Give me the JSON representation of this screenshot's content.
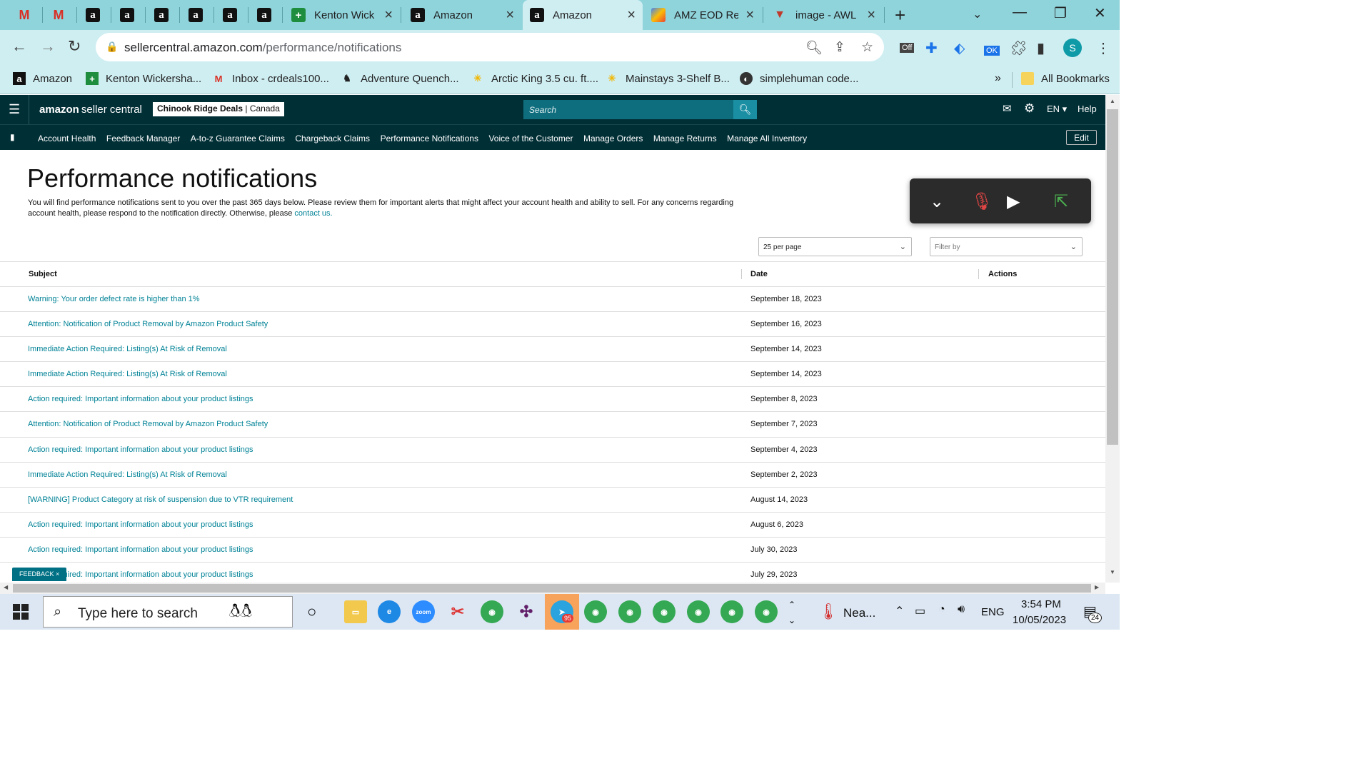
{
  "browser": {
    "tabs": [
      {
        "icon": "gmail-icon",
        "title": ""
      },
      {
        "icon": "gmail-icon",
        "title": ""
      },
      {
        "icon": "amazon-icon",
        "title": ""
      },
      {
        "icon": "amazon-icon",
        "title": ""
      },
      {
        "icon": "amazon-icon",
        "title": ""
      },
      {
        "icon": "amazon-icon",
        "title": ""
      },
      {
        "icon": "amazon-icon",
        "title": ""
      },
      {
        "icon": "amazon-icon",
        "title": ""
      },
      {
        "icon": "sheets-icon",
        "title": "Kenton Wick"
      },
      {
        "icon": "amazon-icon",
        "title": "Amazon"
      },
      {
        "icon": "amazon-icon",
        "title": "Amazon"
      },
      {
        "icon": "colorful-app-icon",
        "title": "AMZ EOD Re"
      },
      {
        "icon": "awl-icon",
        "title": "image - AWL"
      }
    ],
    "url_host": "sellercentral.amazon.com",
    "url_path": "/performance/notifications",
    "bookmarks": [
      {
        "icon": "amazon-icon",
        "label": "Amazon"
      },
      {
        "icon": "plus-icon",
        "label": "Kenton Wickersha..."
      },
      {
        "icon": "gmail-icon",
        "label": "Inbox - crdeals100..."
      },
      {
        "icon": "moose-icon",
        "label": "Adventure Quench..."
      },
      {
        "icon": "walmart-icon",
        "label": "Arctic King 3.5 cu. ft...."
      },
      {
        "icon": "walmart-icon",
        "label": "Mainstays 3-Shelf B..."
      },
      {
        "icon": "globe-icon",
        "label": "simplehuman code..."
      }
    ],
    "bookmarks_overflow": "»",
    "all_bookmarks": "All Bookmarks",
    "profile_initial": "S",
    "ext_off_badge": "Off",
    "ext_ok_badge": "OK"
  },
  "seller_central": {
    "logo_brand": "amazon",
    "logo_product": "seller central",
    "store_name": "Chinook Ridge Deals",
    "store_region": "Canada",
    "search_placeholder": "Search",
    "language": "EN",
    "help": "Help",
    "nav_links": [
      "Account Health",
      "Feedback Manager",
      "A-to-z Guarantee Claims",
      "Chargeback Claims",
      "Performance Notifications",
      "Voice of the Customer",
      "Manage Orders",
      "Manage Returns",
      "Manage All Inventory"
    ],
    "edit_label": "Edit"
  },
  "page": {
    "title": "Performance notifications",
    "intro": "You will find performance notifications sent to you over the past 365 days below. Please review them for important alerts that might affect your account health and ability to sell. For any concerns regarding account health, please respond to the notification directly. Otherwise, please ",
    "contact_link": "contact us.",
    "per_page": "25 per page",
    "filter_placeholder": "Filter by",
    "columns": {
      "subject": "Subject",
      "date": "Date",
      "actions": "Actions"
    },
    "rows": [
      {
        "subject": "Warning: Your order defect rate is higher than 1%",
        "date": "September 18, 2023"
      },
      {
        "subject": "Attention: Notification of Product Removal by Amazon Product Safety",
        "date": "September 16, 2023"
      },
      {
        "subject": "Immediate Action Required: Listing(s) At Risk of Removal",
        "date": "September 14, 2023"
      },
      {
        "subject": "Immediate Action Required: Listing(s) At Risk of Removal",
        "date": "September 14, 2023"
      },
      {
        "subject": "Action required: Important information about your product listings",
        "date": "September 8, 2023"
      },
      {
        "subject": "Attention: Notification of Product Removal by Amazon Product Safety",
        "date": "September 7, 2023"
      },
      {
        "subject": "Action required: Important information about your product listings",
        "date": "September 4, 2023"
      },
      {
        "subject": "Immediate Action Required: Listing(s) At Risk of Removal",
        "date": "September 2, 2023"
      },
      {
        "subject": "[WARNING] Product Category at risk of suspension due to VTR requirement",
        "date": "August 14, 2023"
      },
      {
        "subject": "Action required: Important information about your product listings",
        "date": "August 6, 2023"
      },
      {
        "subject": "Action required: Important information about your product listings",
        "date": "July 30, 2023"
      },
      {
        "subject": "Action required: Important information about your product listings",
        "date": "July 29, 2023"
      }
    ],
    "feedback_label": "FEEDBACK ×"
  },
  "taskbar": {
    "search_placeholder": "Type here to search",
    "telegram_badge": "95",
    "weather_label": "Nea...",
    "language": "ENG",
    "time": "3:54 PM",
    "date": "10/05/2023",
    "notification_count": "24"
  },
  "colors": {
    "header_bg": "#002f36",
    "link": "#008296",
    "tab_strip": "#8fd3db",
    "toolbar": "#cfeef2"
  }
}
